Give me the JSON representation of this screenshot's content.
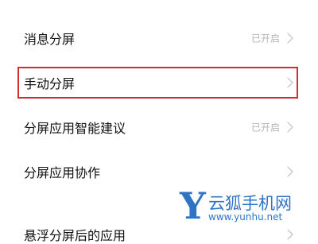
{
  "settings": {
    "items": [
      {
        "label": "消息分屏",
        "status": "已开启"
      },
      {
        "label": "手动分屏",
        "status": ""
      },
      {
        "label": "分屏应用智能建议",
        "status": "已开启"
      },
      {
        "label": "分屏应用协作",
        "status": ""
      }
    ],
    "partial_item": {
      "label": "悬浮分屏后的应用"
    }
  },
  "icons": {
    "chevron": "chevron-right-icon"
  },
  "colors": {
    "highlight_border": "#d62c2c",
    "status_text": "#b5b5b5",
    "chevron": "#c4c4c4",
    "watermark": "#2f74c4"
  },
  "watermark": {
    "letter": "Y",
    "name": "云狐手机网",
    "url": "www.yunhu.net"
  }
}
